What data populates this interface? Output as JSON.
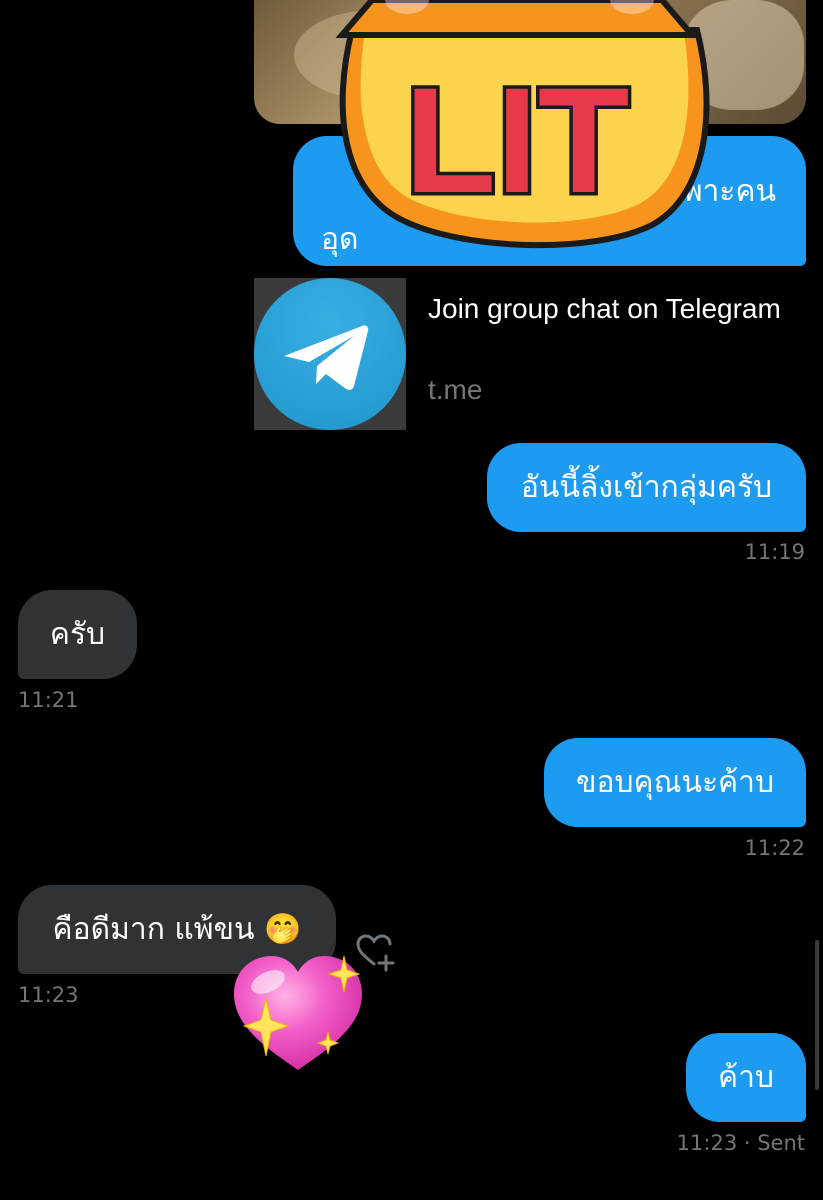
{
  "messages": {
    "partial_top": {
      "line1": "พาะคน",
      "line2": "อุด"
    },
    "link_card": {
      "title": "Join group chat on Telegram",
      "domain": "t.me",
      "icon": "telegram-logo-icon"
    },
    "m1": {
      "text": "อันนี้ลิ้งเข้ากลุ่มครับ",
      "time": "11:19",
      "direction": "out"
    },
    "m2": {
      "text": "ครับ",
      "time": "11:21",
      "direction": "in"
    },
    "m3": {
      "text": "ขอบคุณนะค้าบ",
      "time": "11:22",
      "direction": "out"
    },
    "m4": {
      "text": "คือดีมาก แพ้ขน 🤭",
      "time": "11:23",
      "direction": "in",
      "reaction": "💖"
    },
    "m5": {
      "text": "ค้าบ",
      "time": "11:23 · Sent",
      "direction": "out"
    }
  },
  "sticker": {
    "text": "LIT"
  },
  "colors": {
    "outgoing_bubble": "#1d9bf0",
    "incoming_bubble": "#2f3336",
    "timestamp": "#71767b",
    "background": "#000000"
  }
}
